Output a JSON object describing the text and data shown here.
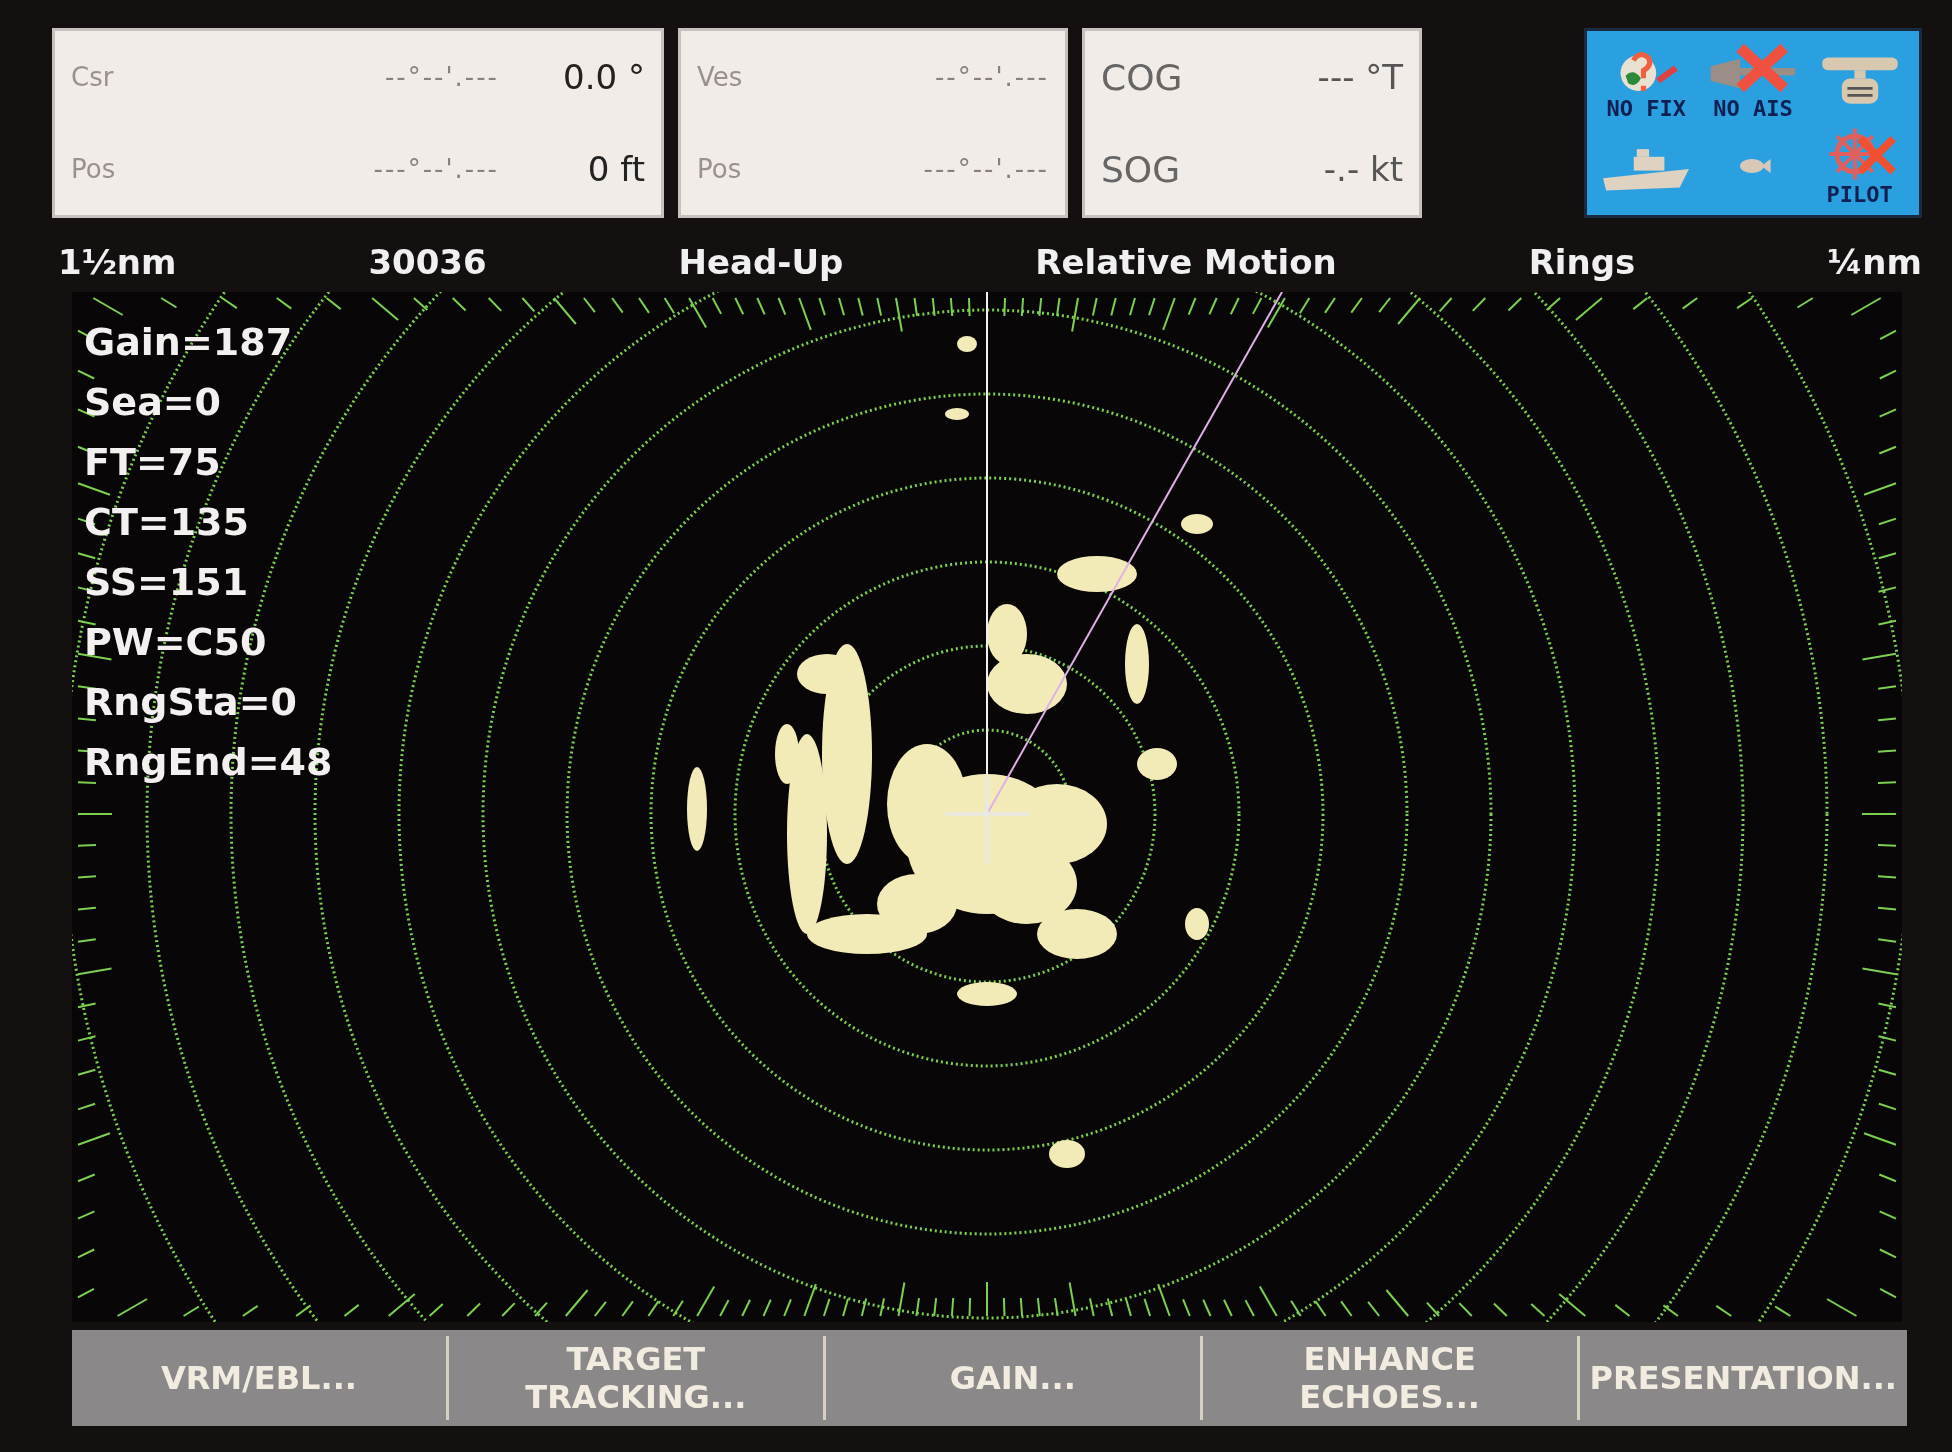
{
  "data_boxes": [
    {
      "rows": [
        {
          "label": "Csr",
          "coordinate": "--°--'.---",
          "value": "0.0 °"
        },
        {
          "label": "Pos",
          "coordinate": "---°--'.---",
          "value": "0 ft"
        }
      ]
    },
    {
      "rows": [
        {
          "label": "Ves",
          "coordinate": "--°--'.---"
        },
        {
          "label": "Pos",
          "coordinate": "---°--'.---"
        }
      ]
    },
    {
      "rows": [
        {
          "label": "COG",
          "value": "--- °T"
        },
        {
          "label": "SOG",
          "value": "-.- kt"
        }
      ]
    }
  ],
  "status_icons": [
    {
      "kind": "no-fix",
      "label": "NO FIX"
    },
    {
      "kind": "no-ais",
      "label": "NO AIS"
    },
    {
      "kind": "scanner"
    },
    {
      "kind": "boat"
    },
    {
      "kind": "fish"
    },
    {
      "kind": "pilot",
      "label": "PILOT"
    }
  ],
  "status_bar": [
    "1½nm",
    "30036",
    "Head-Up",
    "Relative Motion",
    "Rings",
    "¼nm"
  ],
  "radar_settings": [
    "Gain=187",
    "Sea=0",
    "FT=75",
    "CT=135",
    "SS=151",
    "PW=C50",
    "RngSta=0",
    "RngEnd=48"
  ],
  "soft_keys": [
    "VRM/EBL...",
    "TARGET TRACKING...",
    "GAIN...",
    "ENHANCE ECHOES...",
    "PRESENTATION..."
  ]
}
